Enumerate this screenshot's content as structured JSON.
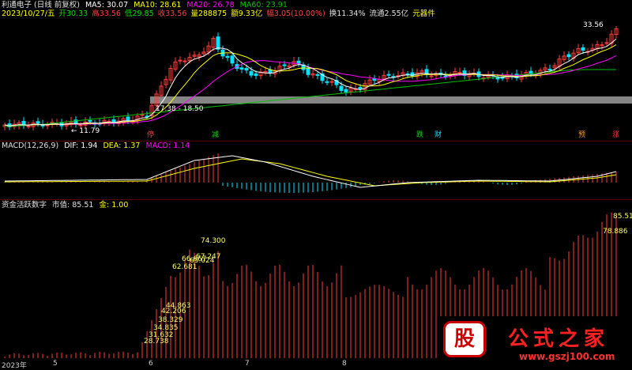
{
  "main": {
    "title": "利通电子 (日线 前复权)",
    "ma": {
      "ma5": "MA5: 30.07",
      "ma10": "MA10: 28.61",
      "ma20": "MA20: 26.78",
      "ma60": "MA60: 23.91"
    },
    "quote": {
      "date": "2023/10/27/五",
      "open": "开30.33",
      "high": "高33.56",
      "low": "低29.85",
      "close": "收33.56",
      "volume": "量288875",
      "amount": "额9.33亿",
      "change": "幅3.05(10.00%)",
      "turnover": "换11.34%",
      "float": "流通2.55亿",
      "industry": "元器件"
    },
    "band_label": "17.38 - 18.50",
    "low_label": "← 11.79",
    "high_label": "33.56",
    "tags": [
      "停",
      "减",
      "跌",
      "财",
      "预",
      "涨"
    ]
  },
  "macd": {
    "title": "MACD(12,26,9)",
    "dif": "DIF: 1.94",
    "dea": "DEA: 1.37",
    "macd": "MACD: 1.14"
  },
  "fund": {
    "title": "资金活跃数字",
    "market": "市值: 85.51",
    "gold": "金: 1.00",
    "values": [
      "28.738",
      "31.632",
      "34.835",
      "38.329",
      "42.206",
      "44.863",
      "62.681",
      "66.667",
      "67.247",
      "65.024",
      "74.300",
      "78.886",
      "85.51"
    ]
  },
  "xaxis": {
    "labels": [
      "2023年",
      "5",
      "6",
      "7",
      "8"
    ]
  },
  "watermark": {
    "stock": "股",
    "text": "公式之家",
    "url": "www.gszj100.com"
  },
  "colors": {
    "up": "#ff3b3b",
    "down": "#00e5ff",
    "ma5": "#ffffff",
    "ma10": "#ffff00",
    "ma20": "#ff00ff",
    "ma60": "#00c000",
    "band": "#9a9a9a"
  }
}
